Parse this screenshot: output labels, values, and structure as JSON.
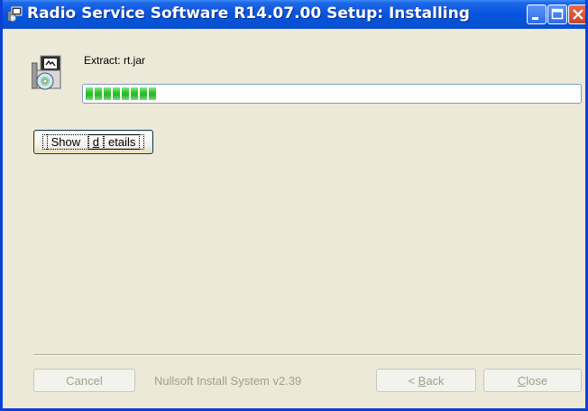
{
  "window": {
    "title": "Radio Service Software R14.07.00 Setup: Installing"
  },
  "status": {
    "label": "Extract: rt.jar",
    "progress_percent": 15
  },
  "buttons": {
    "show_details_prefix": "Show ",
    "show_details_accel": "d",
    "show_details_suffix": "etails",
    "cancel": "Cancel",
    "back_prefix": "< ",
    "back_accel": "B",
    "back_suffix": "ack",
    "close_accel": "C",
    "close_suffix": "lose"
  },
  "branding": {
    "text": "Nullsoft Install System v2.39"
  },
  "icons": {
    "title": "installer-icon",
    "status": "installer-cd-icon"
  },
  "colors": {
    "titlebar": "#0A55E0",
    "progress": "#2FC42E",
    "window_bg": "#ECE9D8"
  }
}
